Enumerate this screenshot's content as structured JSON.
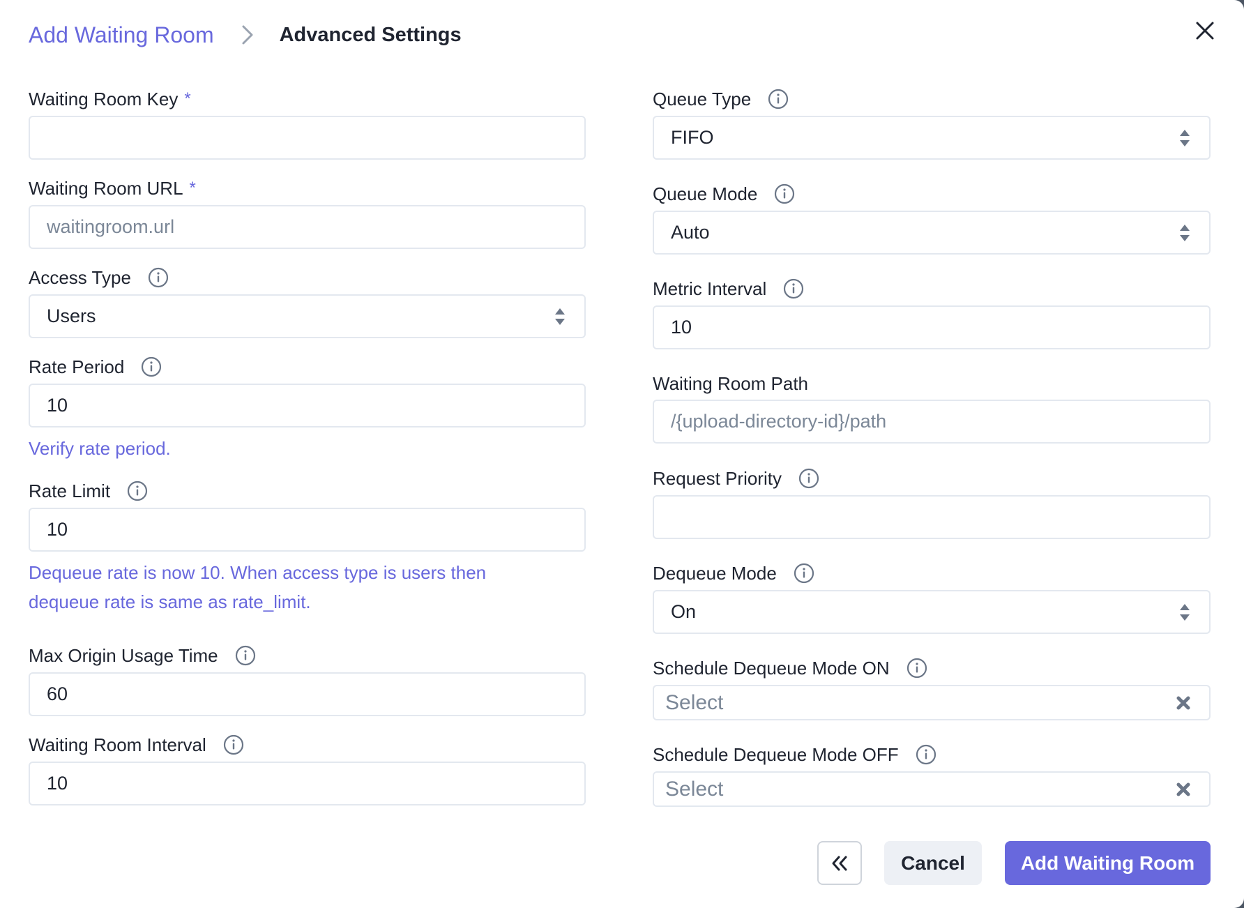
{
  "breadcrumb": {
    "parent": "Add Waiting Room",
    "current": "Advanced Settings",
    "separator_icon": "chevron-right-icon"
  },
  "close_icon": "close-icon",
  "colors": {
    "accent": "#6868dd",
    "text": "#1f2430",
    "muted": "#7b8797",
    "border": "#e3e8ef",
    "secondary_button_bg": "#edf0f5"
  },
  "left_column": {
    "waiting_room_key": {
      "label": "Waiting Room Key",
      "required_marker": "*",
      "value": "",
      "placeholder": ""
    },
    "waiting_room_url": {
      "label": "Waiting Room URL",
      "required_marker": "*",
      "value": "",
      "placeholder": "waitingroom.url"
    },
    "access_type": {
      "label": "Access Type",
      "value": "Users",
      "type": "select"
    },
    "rate_period": {
      "label": "Rate Period",
      "value": "10",
      "hint": "Verify rate period."
    },
    "rate_limit": {
      "label": "Rate Limit",
      "value": "10",
      "hint_line1": "Dequeue rate is now 10. When access type is users then",
      "hint_line2": "dequeue rate is same as rate_limit."
    },
    "max_origin_usage_time": {
      "label": "Max Origin Usage Time",
      "value": "60"
    },
    "waiting_room_interval": {
      "label": "Waiting Room Interval",
      "value": "10"
    }
  },
  "right_column": {
    "queue_type": {
      "label": "Queue Type",
      "value": "FIFO",
      "type": "select"
    },
    "queue_mode": {
      "label": "Queue Mode",
      "value": "Auto",
      "type": "select"
    },
    "metric_interval": {
      "label": "Metric Interval",
      "value": "10"
    },
    "waiting_room_path": {
      "label": "Waiting Room Path",
      "value": "",
      "placeholder": "/{upload-directory-id}/path"
    },
    "request_priority": {
      "label": "Request Priority",
      "value": ""
    },
    "dequeue_mode": {
      "label": "Dequeue Mode",
      "value": "On",
      "type": "select"
    },
    "schedule_on": {
      "label": "Schedule Dequeue Mode ON",
      "placeholder": "Select"
    },
    "schedule_off": {
      "label": "Schedule Dequeue Mode OFF",
      "placeholder": "Select"
    }
  },
  "footer": {
    "back_icon": "double-chevron-left-icon",
    "cancel_label": "Cancel",
    "submit_label": "Add Waiting Room"
  }
}
